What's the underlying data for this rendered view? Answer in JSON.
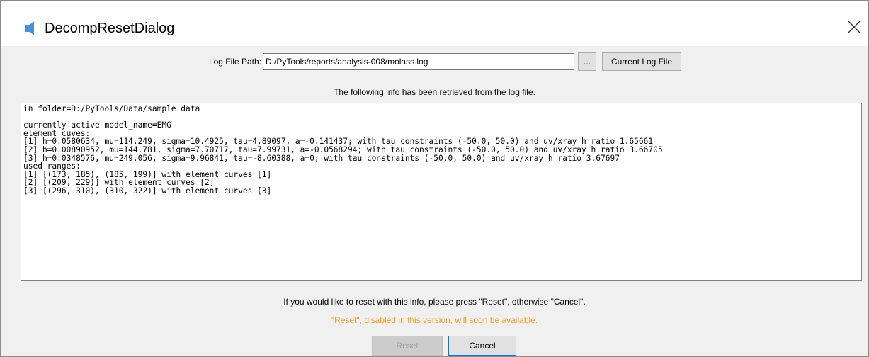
{
  "window": {
    "title": "DecompResetDialog"
  },
  "log_path": {
    "label": "Log File Path:",
    "value": "D:/PyTools/reports/analysis-008/molass.log",
    "browse_label": "...",
    "current_button_label": "Current Log File"
  },
  "info_caption": "The following info has been retrieved from the log file.",
  "log_text": "in_folder=D:/PyTools/Data/sample_data\n\ncurrently active model_name=EMG\nelement cuves:\n[1] h=0.0580634, mu=114.249, sigma=10.4925, tau=4.89097, a=-0.141437; with tau constraints (-50.0, 50.0) and uv/xray h ratio 1.65661\n[2] h=0.00890952, mu=144.781, sigma=7.70717, tau=7.99731, a=-0.0568294; with tau constraints (-50.0, 50.0) and uv/xray h ratio 3.66705\n[3] h=0.0348576, mu=249.056, sigma=9.96841, tau=-8.60388, a=0; with tau constraints (-50.0, 50.0) and uv/xray h ratio 3.67697\nused ranges:\n[1] [(173, 185), (185, 199)] with element curves [1]\n[2] [(209, 229)] with element curves [2]\n[3] [(296, 310), (310, 322)] with element curves [3]",
  "prompt": "If you would like to reset with this info, please press \"Reset\", otherwise \"Cancel\".",
  "warning": "\"Reset\", disabled in this version, will soon be available.",
  "buttons": {
    "reset": "Reset",
    "cancel": "Cancel"
  },
  "colors": {
    "warning": "#ff9a1f",
    "icon": "#4a90d9",
    "focus_border": "#0078d7"
  },
  "icons": {
    "app": "window-app-icon",
    "close": "close-icon"
  }
}
